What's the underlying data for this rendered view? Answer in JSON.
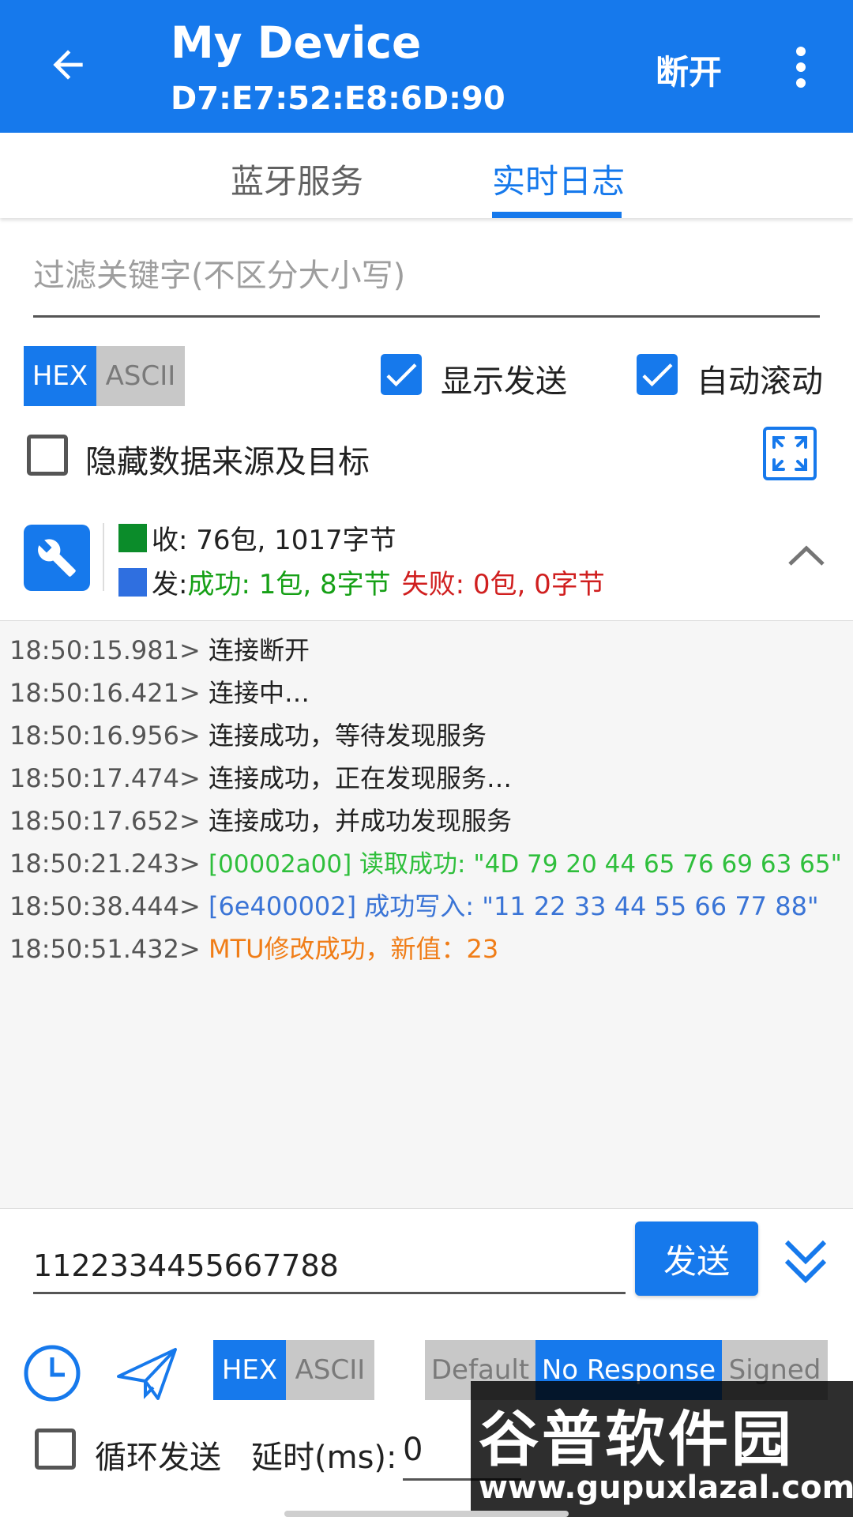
{
  "header": {
    "title": "My Device",
    "subtitle": "D7:E7:52:E8:6D:90",
    "disconnect_label": "断开"
  },
  "tabs": [
    {
      "label": "蓝牙服务",
      "active": false
    },
    {
      "label": "实时日志",
      "active": true
    }
  ],
  "filter": {
    "placeholder": "过滤关键字(不区分大小写)",
    "value": ""
  },
  "display_format": {
    "options": [
      "HEX",
      "ASCII"
    ],
    "selected": "HEX"
  },
  "options": {
    "show_send": {
      "label": "显示发送",
      "checked": true
    },
    "auto_scroll": {
      "label": "自动滚动",
      "checked": true
    },
    "hide_source": {
      "label": "隐藏数据来源及目标",
      "checked": false
    }
  },
  "stats": {
    "recv_prefix": "收: ",
    "recv_text": "76包, 1017字节",
    "send_prefix": "发: ",
    "send_success": "成功: 1包, 8字节",
    "send_fail": "失败: 0包, 0字节",
    "colors": {
      "recv": "#0b8c2a",
      "send": "#2f6fe0",
      "success": "#16a016",
      "fail": "#d01f1f"
    }
  },
  "log": [
    {
      "time": "18:50:15.981>",
      "msg": "连接断开",
      "color": "#212121"
    },
    {
      "time": "18:50:16.421>",
      "msg": "连接中…",
      "color": "#212121"
    },
    {
      "time": "18:50:16.956>",
      "msg": "连接成功，等待发现服务",
      "color": "#212121"
    },
    {
      "time": "18:50:17.474>",
      "msg": "连接成功，正在发现服务…",
      "color": "#212121"
    },
    {
      "time": "18:50:17.652>",
      "msg": "连接成功，并成功发现服务",
      "color": "#212121"
    },
    {
      "time": "18:50:21.243>",
      "msg": "[00002a00] 读取成功: \"4D 79 20 44 65 76 69 63 65\"",
      "color": "#2fbf3c"
    },
    {
      "time": "18:50:38.444>",
      "msg": "[6e400002] 成功写入: \"11 22 33 44 55 66 77 88\"",
      "color": "#3a74d6"
    },
    {
      "time": "18:50:51.432>",
      "msg": "MTU修改成功，新值：23",
      "color": "#f07d17"
    }
  ],
  "send": {
    "input_value": "1122334455667788",
    "button_label": "发送"
  },
  "send_format": {
    "options": [
      "HEX",
      "ASCII"
    ],
    "selected": "HEX"
  },
  "write_type": {
    "options": [
      "Default",
      "No Response",
      "Signed"
    ],
    "selected": "No Response"
  },
  "loop": {
    "label": "循环发送",
    "checked": false
  },
  "delay": {
    "label": "延时(ms): ",
    "value": "0"
  },
  "watermark": {
    "text": "谷普软件园",
    "url": "www.gupuxlazal.com"
  },
  "colors": {
    "accent": "#1679ec"
  }
}
